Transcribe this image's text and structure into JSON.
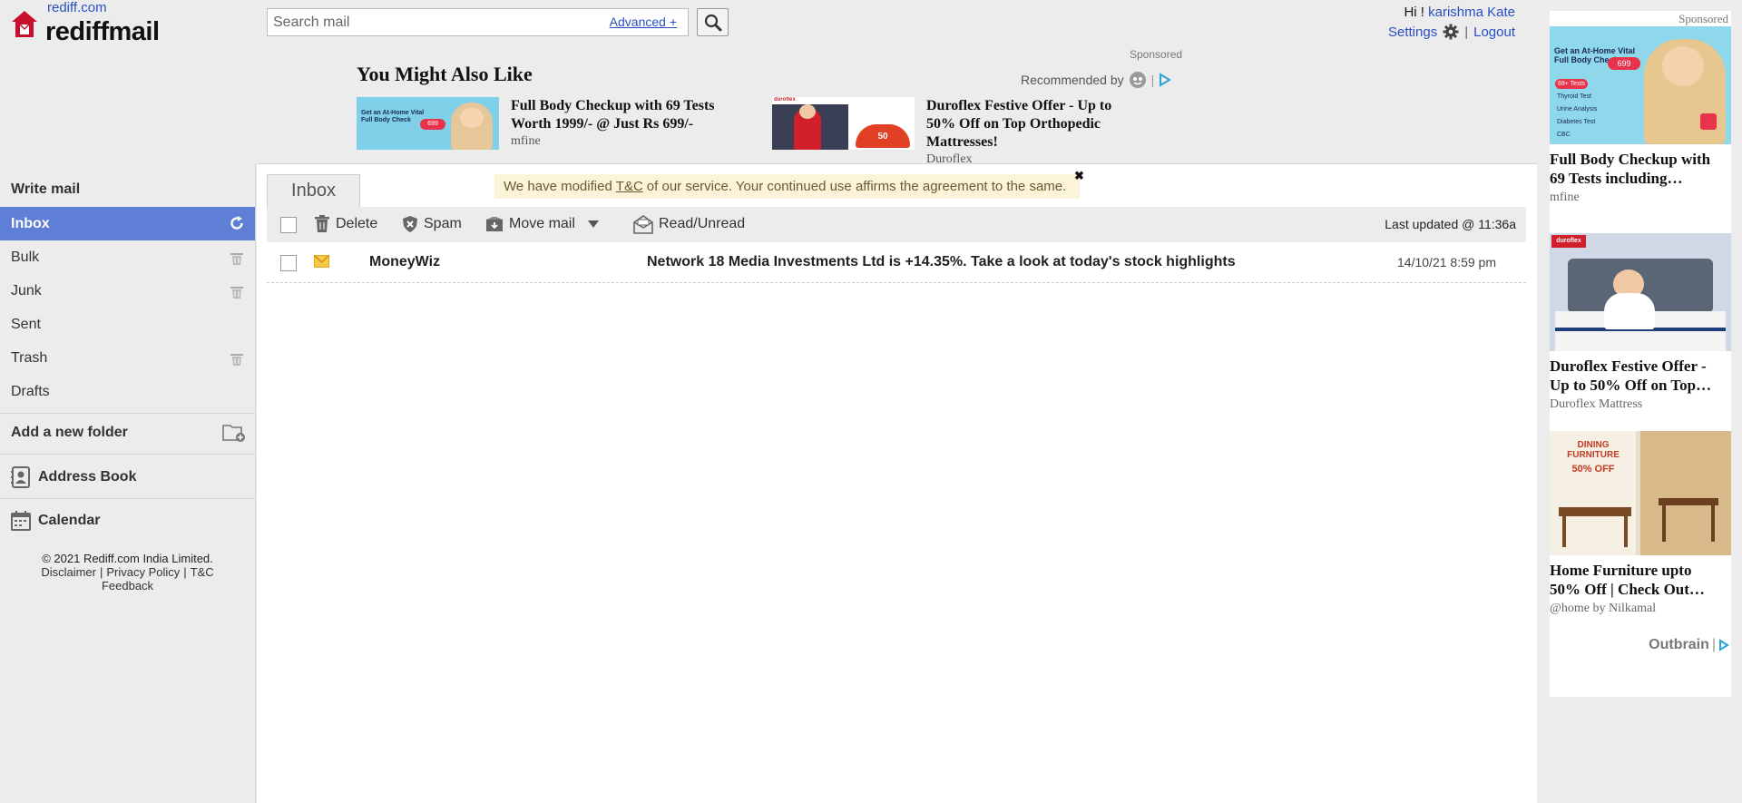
{
  "header": {
    "site_link": "rediff.com",
    "brand": "rediffmail",
    "search_placeholder": "Search mail",
    "advanced_label": "Advanced +",
    "greeting": "Hi !",
    "user_name": "karishma Kate",
    "settings_label": "Settings",
    "logout_label": "Logout"
  },
  "recommendations": {
    "title": "You Might Also Like",
    "sponsored": "Sponsored",
    "recommended_by": "Recommended by",
    "items": [
      {
        "title": "Full Body Checkup with 69 Tests Worth 1999/- @ Just Rs 699/-",
        "source": "mfine",
        "thumb_text": "Get an At-Home Vital Full Body Check",
        "thumb_price": "699"
      },
      {
        "title": "Duroflex Festive Offer - Up to 50% Off on Top Orthopedic Mattresses!",
        "source": "Duroflex",
        "thumb_text": "duroflex",
        "thumb_price": "50"
      }
    ]
  },
  "sidebar": {
    "write_mail": "Write mail",
    "folders": [
      {
        "label": "Inbox",
        "active": true
      },
      {
        "label": "Bulk"
      },
      {
        "label": "Junk"
      },
      {
        "label": "Sent"
      },
      {
        "label": "Trash"
      },
      {
        "label": "Drafts"
      }
    ],
    "add_folder": "Add a new folder",
    "address_book": "Address Book",
    "calendar": "Calendar",
    "footer": {
      "copyright": "© 2021 Rediff.com India Limited.",
      "disclaimer": "Disclaimer",
      "privacy": "Privacy Policy",
      "tc": "T&C",
      "feedback": "Feedback"
    }
  },
  "main": {
    "tab_label": "Inbox",
    "notice_pre": "We have modified",
    "notice_link": "T&C",
    "notice_post": "of our service. Your continued use affirms the agreement to the same.",
    "notice_close": "✖",
    "toolbar": {
      "delete": "Delete",
      "spam": "Spam",
      "move_mail": "Move mail",
      "read_unread": "Read/Unread",
      "last_updated": "Last updated  @ 11:36a"
    },
    "mails": [
      {
        "from": "MoneyWiz",
        "subject": "Network 18 Media Investments Ltd is +14.35%. Take a look at today's stock highlights",
        "date": "14/10/21 8:59 pm"
      }
    ]
  },
  "ads": {
    "sponsored": "Sponsored",
    "items": [
      {
        "title": "Full Body Checkup with 69 Tests including…",
        "source": "mfine",
        "img_text": "Get an At-Home Vital Full Body Check",
        "img_price": "699",
        "img_list": [
          "69+ Tests",
          "Thyroid Test",
          "Urine Analysis",
          "Diabetes Test",
          "CBC"
        ]
      },
      {
        "title": "Duroflex Festive Offer - Up to 50% Off on Top…",
        "source": "Duroflex Mattress",
        "img_text": "duroflex"
      },
      {
        "title": "Home Furniture upto 50% Off | Check Out…",
        "source": "@home by Nilkamal",
        "img_text": "DINING FURNITURE",
        "img_price": "50% OFF"
      }
    ],
    "outbrain": "Outbrain"
  },
  "colors": {
    "accent": "#5f7fd6",
    "link": "#2a4fc4",
    "notice_bg": "#fcf4d8",
    "envelope": "#f0b429"
  }
}
